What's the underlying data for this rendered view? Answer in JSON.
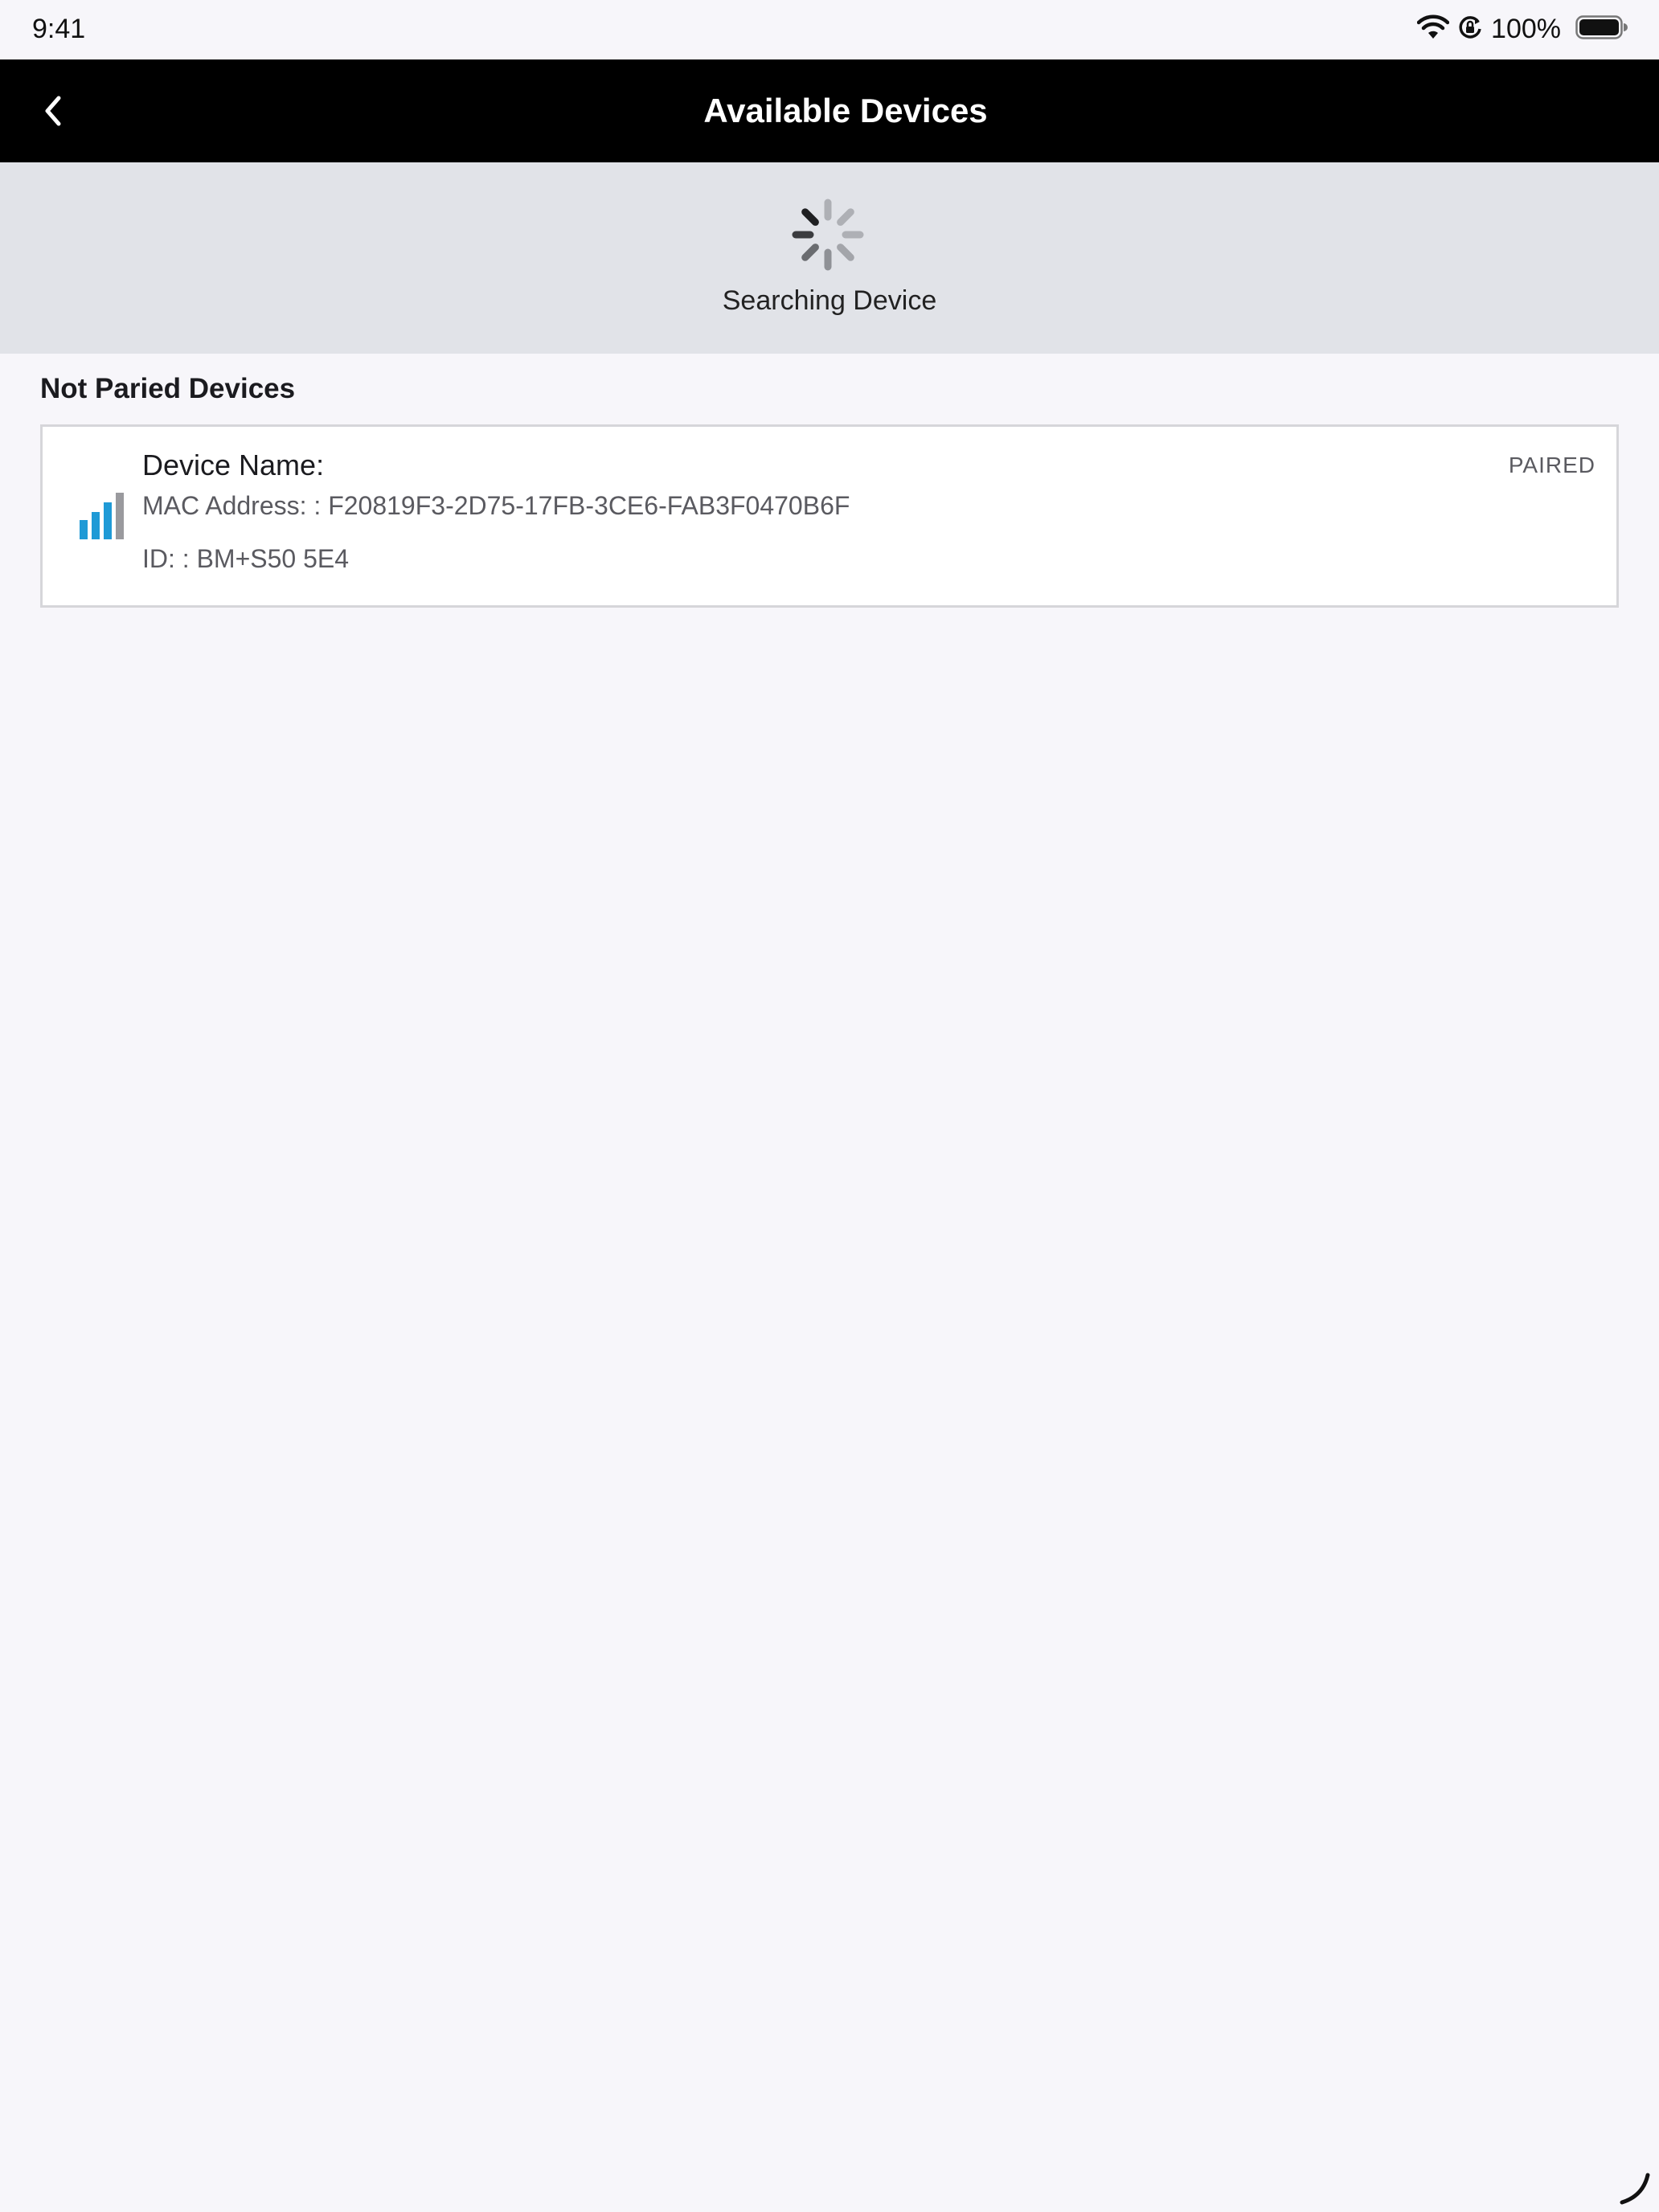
{
  "status_bar": {
    "time": "9:41",
    "battery_percent": "100%",
    "icons": [
      "wifi-icon",
      "orientation-lock-icon",
      "battery-icon"
    ]
  },
  "nav": {
    "title": "Available Devices",
    "back_icon": "chevron-left-icon"
  },
  "search": {
    "label": "Searching Device",
    "icon": "activity-spinner-icon"
  },
  "section": {
    "title": "Not Paried Devices"
  },
  "devices": [
    {
      "name": "Device Name:",
      "mac": "MAC Address: : F20819F3-2D75-17FB-3CE6-FAB3F0470B6F",
      "id": "ID: : BM+S50 5E4",
      "status": "PAIRED",
      "icon": "signal-strength-icon",
      "signal_bars_active": 3,
      "signal_bars_total": 4
    }
  ],
  "colors": {
    "nav_background": "#000000",
    "banner_background": "#e1e3e8",
    "page_background": "#f7f6fa",
    "signal_active": "#1f9ad6",
    "signal_inactive": "#9a9a9e"
  }
}
